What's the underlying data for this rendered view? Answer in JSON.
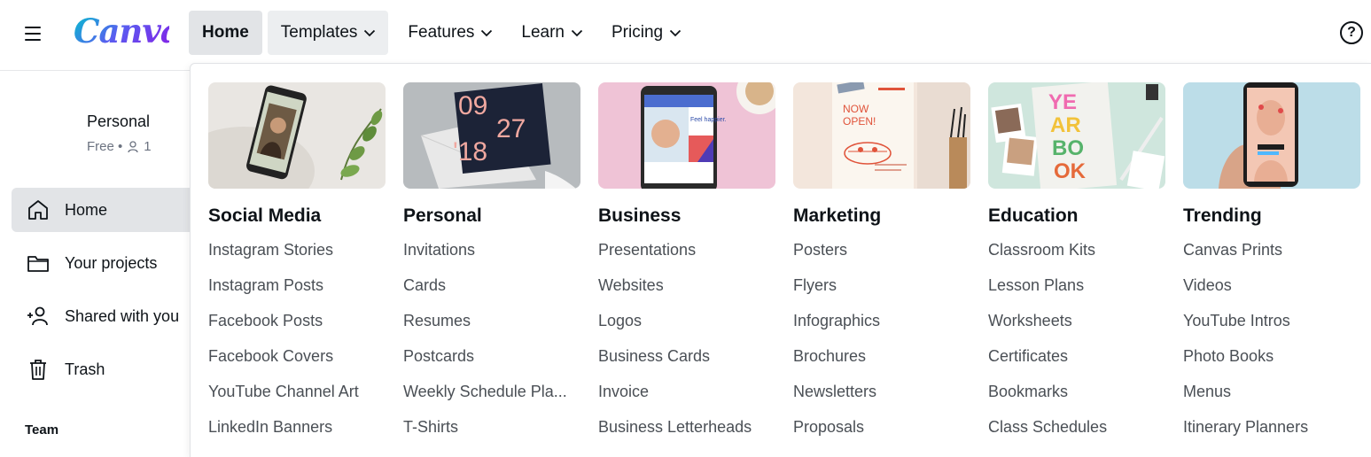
{
  "brand": {
    "logo_text": "Canva"
  },
  "nav": {
    "items": [
      {
        "label": "Home"
      },
      {
        "label": "Templates"
      },
      {
        "label": "Features"
      },
      {
        "label": "Learn"
      },
      {
        "label": "Pricing"
      }
    ],
    "help_label": "?"
  },
  "sidebar": {
    "account_name": "Personal",
    "plan": "Free •",
    "members": "1",
    "items": [
      {
        "label": "Home",
        "icon": "home-icon"
      },
      {
        "label": "Your projects",
        "icon": "folder-icon"
      },
      {
        "label": "Shared with you",
        "icon": "shared-users-icon"
      },
      {
        "label": "Trash",
        "icon": "trash-icon"
      }
    ],
    "team_label": "Team"
  },
  "templates_menu": {
    "columns": [
      {
        "title": "Social Media",
        "links": [
          "Instagram Stories",
          "Instagram Posts",
          "Facebook Posts",
          "Facebook Covers",
          "YouTube Channel Art",
          "LinkedIn Banners"
        ]
      },
      {
        "title": "Personal",
        "links": [
          "Invitations",
          "Cards",
          "Resumes",
          "Postcards",
          "Weekly Schedule Pla...",
          "T-Shirts"
        ]
      },
      {
        "title": "Business",
        "links": [
          "Presentations",
          "Websites",
          "Logos",
          "Business Cards",
          "Invoice",
          "Business Letterheads"
        ]
      },
      {
        "title": "Marketing",
        "links": [
          "Posters",
          "Flyers",
          "Infographics",
          "Brochures",
          "Newsletters",
          "Proposals"
        ]
      },
      {
        "title": "Education",
        "links": [
          "Classroom Kits",
          "Lesson Plans",
          "Worksheets",
          "Certificates",
          "Bookmarks",
          "Class Schedules"
        ]
      },
      {
        "title": "Trending",
        "links": [
          "Canvas Prints",
          "Videos",
          "YouTube Intros",
          "Photo Books",
          "Menus",
          "Itinerary Planners"
        ]
      }
    ],
    "thumb_text": {
      "personal": [
        "09",
        "27",
        "'18"
      ],
      "business": "Feel happier.",
      "marketing_now": "NOW",
      "marketing_open": "OPEN!",
      "education": [
        "YE",
        "AR",
        "BO",
        "OK"
      ]
    }
  },
  "colors": {
    "accent_gradient_start": "#00c4cc",
    "accent_gradient_end": "#7d2ae8",
    "active_bg": "#e2e4e7",
    "text_primary": "#0e1318",
    "text_secondary": "#4a4f55"
  }
}
